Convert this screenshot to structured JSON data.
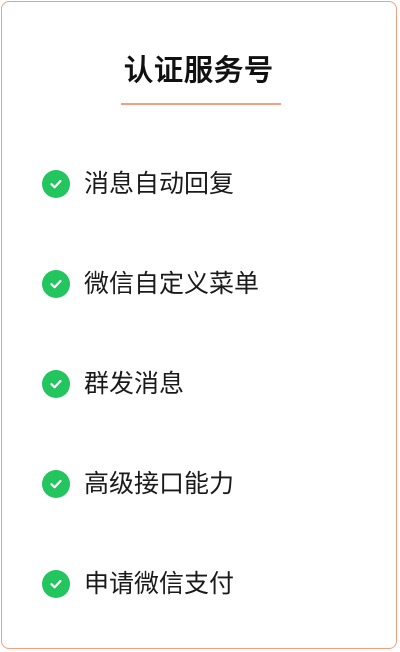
{
  "title": "认证服务号",
  "colors": {
    "accent": "#f2a07d",
    "check": "#22c55e",
    "text": "#1a1a1a"
  },
  "features": [
    {
      "label": "消息自动回复",
      "icon": "check-circle-icon"
    },
    {
      "label": "微信自定义菜单",
      "icon": "check-circle-icon"
    },
    {
      "label": "群发消息",
      "icon": "check-circle-icon"
    },
    {
      "label": "高级接口能力",
      "icon": "check-circle-icon"
    },
    {
      "label": "申请微信支付",
      "icon": "check-circle-icon"
    }
  ]
}
